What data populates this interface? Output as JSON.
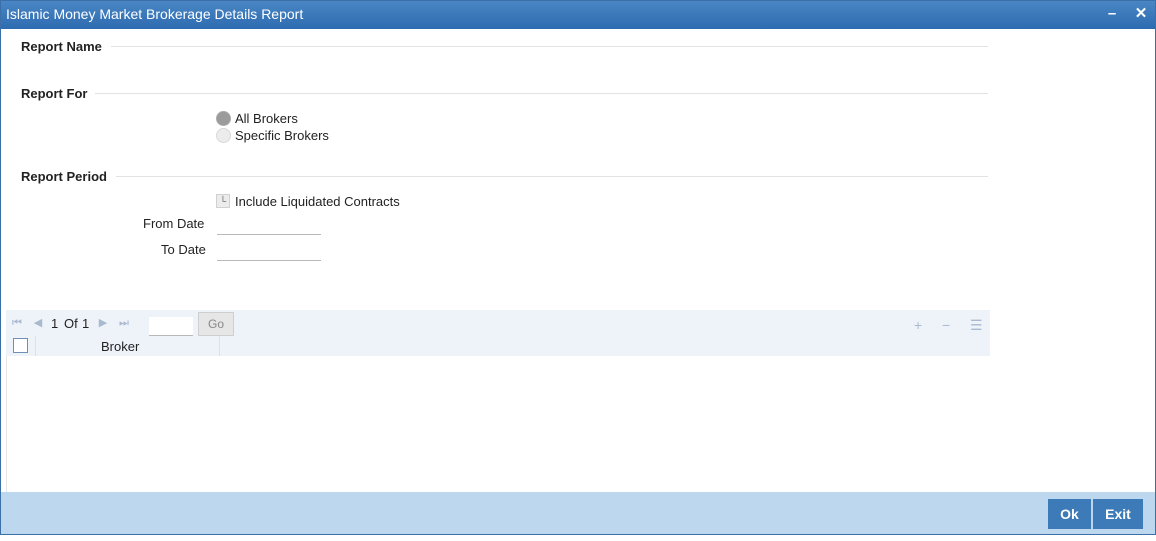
{
  "window": {
    "title": "Islamic Money Market Brokerage Details Report",
    "minimize_icon": "minimize-icon",
    "close_icon": "close-icon"
  },
  "report_name": {
    "header": "Report Name"
  },
  "report_for": {
    "header": "Report For",
    "options": [
      {
        "label": "All Brokers",
        "selected": true
      },
      {
        "label": "Specific Brokers",
        "selected": false
      }
    ]
  },
  "report_period": {
    "header": "Report Period",
    "include_liquidated_label": "Include Liquidated Contracts",
    "include_liquidated_checked": false,
    "from_date_label": "From Date",
    "from_date_value": "",
    "to_date_label": "To Date",
    "to_date_value": ""
  },
  "grid": {
    "page_current": "1",
    "page_of": "Of",
    "page_total": "1",
    "go_label": "Go",
    "page_input_value": "",
    "columns": [
      "Broker"
    ],
    "rows": [],
    "nav_icons": [
      "first-page-icon",
      "prev-page-icon",
      "next-page-icon",
      "last-page-icon"
    ],
    "tool_icons": [
      "add-row-icon",
      "delete-row-icon",
      "single-view-icon"
    ]
  },
  "footer": {
    "ok_label": "Ok",
    "exit_label": "Exit"
  }
}
